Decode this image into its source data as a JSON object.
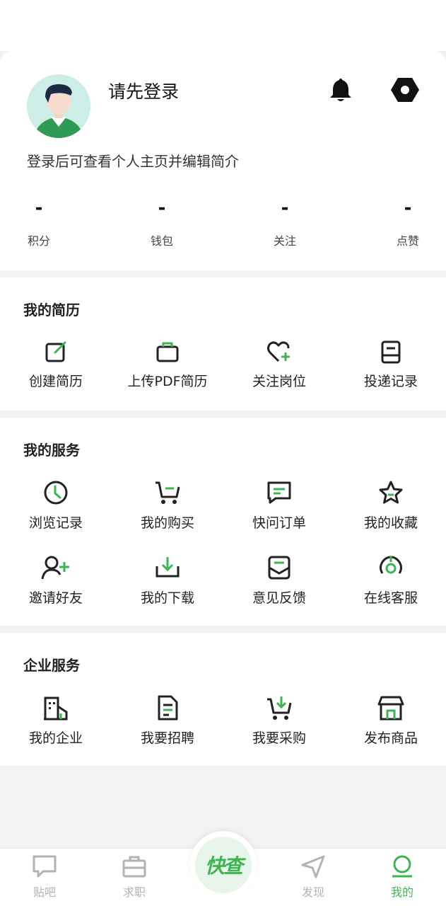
{
  "profile": {
    "title": "请先登录",
    "hint": "登录后可查看个人主页并编辑简介",
    "stats": [
      {
        "value": "-",
        "label": "积分"
      },
      {
        "value": "-",
        "label": "钱包"
      },
      {
        "value": "-",
        "label": "关注"
      },
      {
        "value": "-",
        "label": "点赞"
      }
    ]
  },
  "resume": {
    "title": "我的简历",
    "items": [
      {
        "label": "创建简历",
        "icon": "edit-icon"
      },
      {
        "label": "上传PDF简历",
        "icon": "briefcase-icon"
      },
      {
        "label": "关注岗位",
        "icon": "heart-plus-icon"
      },
      {
        "label": "投递记录",
        "icon": "record-book-icon"
      }
    ]
  },
  "services": {
    "title": "我的服务",
    "items": [
      {
        "label": "浏览记录",
        "icon": "clock-icon"
      },
      {
        "label": "我的购买",
        "icon": "cart-icon"
      },
      {
        "label": "快问订单",
        "icon": "message-icon"
      },
      {
        "label": "我的收藏",
        "icon": "star-icon"
      },
      {
        "label": "邀请好友",
        "icon": "add-user-icon"
      },
      {
        "label": "我的下载",
        "icon": "download-icon"
      },
      {
        "label": "意见反馈",
        "icon": "mail-inbox-icon"
      },
      {
        "label": "在线客服",
        "icon": "headset-icon"
      }
    ]
  },
  "enterprise": {
    "title": "企业服务",
    "items": [
      {
        "label": "我的企业",
        "icon": "building-icon"
      },
      {
        "label": "我要招聘",
        "icon": "document-icon"
      },
      {
        "label": "我要采购",
        "icon": "cart-download-icon"
      },
      {
        "label": "发布商品",
        "icon": "store-icon"
      }
    ]
  },
  "tabbar": {
    "tabs": [
      {
        "label": "贴吧",
        "icon": "chat-bubble-icon"
      },
      {
        "label": "求职",
        "icon": "briefcase-icon"
      },
      {
        "label": "发现",
        "icon": "send-icon"
      },
      {
        "label": "我的",
        "icon": "profile-icon"
      }
    ],
    "center_label": "快查",
    "active_index": 3
  },
  "colors": {
    "accent": "#3db551",
    "inactive": "#b3b3b3",
    "text": "#222222"
  }
}
